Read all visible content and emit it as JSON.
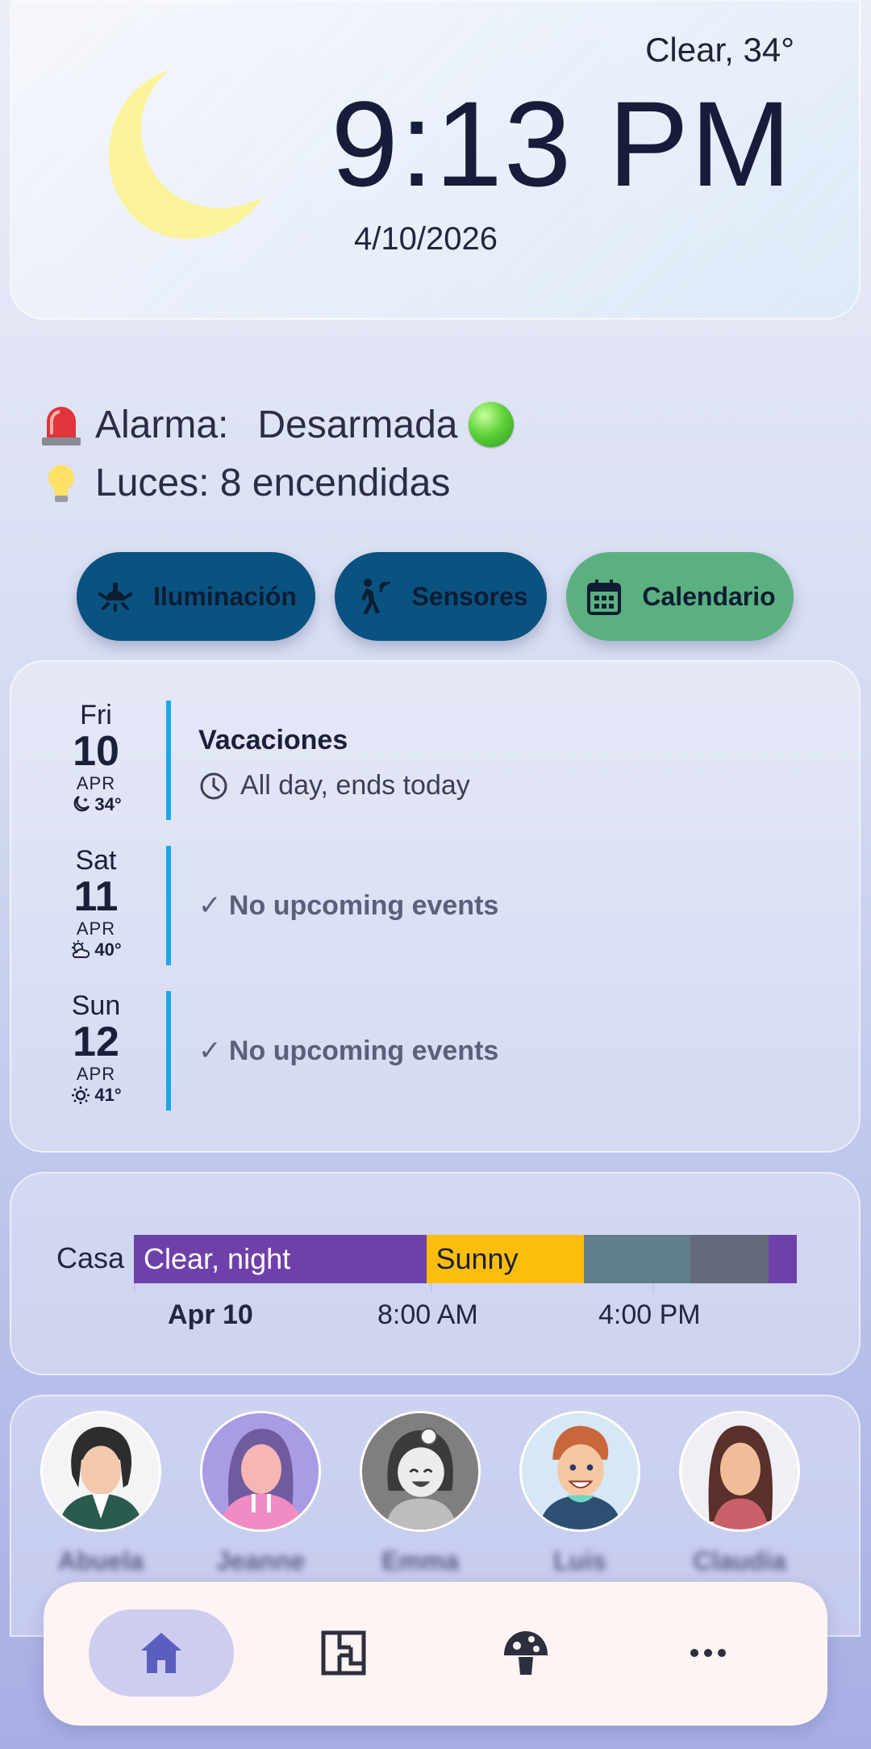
{
  "header": {
    "weather": "Clear, 34°",
    "time": "9:13 PM",
    "date": "4/10/2026",
    "icon": "moon-icon"
  },
  "status": {
    "alarm_label": "Alarma:",
    "alarm_value": "Desarmada",
    "lights_text": "Luces: 8 encendidas"
  },
  "chips": [
    {
      "label": "Iluminación",
      "icon": "ceiling-light-icon"
    },
    {
      "label": "Sensores",
      "icon": "motion-sensor-icon"
    },
    {
      "label": "Calendario",
      "icon": "calendar-icon"
    }
  ],
  "calendar": {
    "days": [
      {
        "dow": "Fri",
        "num": "10",
        "month": "APR",
        "temp": "34°",
        "weather_icon": "night-icon"
      },
      {
        "dow": "Sat",
        "num": "11",
        "month": "APR",
        "temp": "40°",
        "weather_icon": "partly-cloudy-icon"
      },
      {
        "dow": "Sun",
        "num": "12",
        "month": "APR",
        "temp": "41°",
        "weather_icon": "sunny-icon"
      }
    ],
    "event": {
      "title": "Vacaciones",
      "time": "All day, ends today"
    },
    "no_events": "✓ No upcoming events"
  },
  "timeline": {
    "label": "Casa",
    "segments": [
      {
        "label": "Clear, night",
        "share": 0.441,
        "color": "#6f40aa",
        "text_color": "#ffffff"
      },
      {
        "label": "Sunny",
        "share": 0.238,
        "color": "#fcbd0c",
        "text_color": "#1c1f3a"
      },
      {
        "label": "",
        "share": 0.16,
        "color": "#5f7f8c",
        "text_color": "#ffffff"
      },
      {
        "label": "",
        "share": 0.118,
        "color": "#656a7a",
        "text_color": "#ffffff"
      },
      {
        "label": "",
        "share": 0.043,
        "color": "#6f40aa",
        "text_color": "#ffffff"
      }
    ],
    "axis": {
      "date": "Apr 10",
      "t1": "8:00 AM",
      "t2": "4:00 PM"
    }
  },
  "people": [
    {
      "name": "Abuela"
    },
    {
      "name": "Jeanne"
    },
    {
      "name": "Emma"
    },
    {
      "name": "Luis"
    },
    {
      "name": "Claudia"
    }
  ],
  "nav": [
    "home-icon",
    "floorplan-icon",
    "mushroom-icon",
    "more-icon"
  ],
  "colors": {
    "accent_blue": "#0a5280",
    "accent_green": "#5bb07f",
    "bar_blue": "#1aa7e8",
    "nav_active": "#cdcdf0"
  }
}
